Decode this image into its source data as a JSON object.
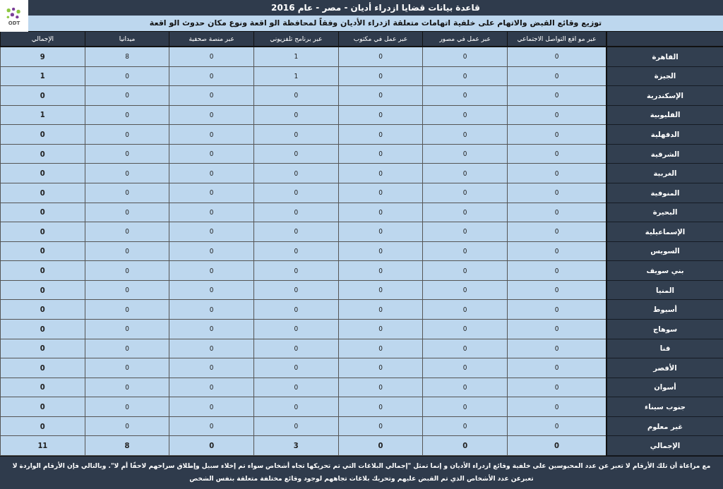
{
  "logo": {
    "text": "ODT"
  },
  "title": "قاعدة بيانات قضايا ازدراء أديان - مصر - عام 2016",
  "subtitle": "توزيع وقائع القبض والاتهام على خلفية اتهامات متعلقة ازدراء الأديان وفقاً لمحافظة الو اقعة ونوع مكان حدوث الو اقعة",
  "table": {
    "columns": [
      "عبر مو اقع التواصل الاجتماعي",
      "عبر عمل في مصور",
      "عبر عمل في مكتوب",
      "عبر برنامج تلفزيوني",
      "عبر منصة صحفية",
      "ميدانيا",
      "الإجمالي"
    ],
    "rows": [
      {
        "label": "القاهرة",
        "values": [
          "0",
          "0",
          "0",
          "1",
          "0",
          "8",
          "9"
        ]
      },
      {
        "label": "الجيزة",
        "values": [
          "0",
          "0",
          "0",
          "1",
          "0",
          "0",
          "1"
        ]
      },
      {
        "label": "الإسكندرية",
        "values": [
          "0",
          "0",
          "0",
          "0",
          "0",
          "0",
          "0"
        ]
      },
      {
        "label": "القليوبية",
        "values": [
          "0",
          "0",
          "0",
          "0",
          "0",
          "0",
          "1"
        ]
      },
      {
        "label": "الدقهلية",
        "values": [
          "0",
          "0",
          "0",
          "0",
          "0",
          "0",
          "0"
        ]
      },
      {
        "label": "الشرقية",
        "values": [
          "0",
          "0",
          "0",
          "0",
          "0",
          "0",
          "0"
        ]
      },
      {
        "label": "الغربية",
        "values": [
          "0",
          "0",
          "0",
          "0",
          "0",
          "0",
          "0"
        ]
      },
      {
        "label": "المنوفية",
        "values": [
          "0",
          "0",
          "0",
          "0",
          "0",
          "0",
          "0"
        ]
      },
      {
        "label": "البحيرة",
        "values": [
          "0",
          "0",
          "0",
          "0",
          "0",
          "0",
          "0"
        ]
      },
      {
        "label": "الإسماعيلية",
        "values": [
          "0",
          "0",
          "0",
          "0",
          "0",
          "0",
          "0"
        ]
      },
      {
        "label": "السويس",
        "values": [
          "0",
          "0",
          "0",
          "0",
          "0",
          "0",
          "0"
        ]
      },
      {
        "label": "بني سويف",
        "values": [
          "0",
          "0",
          "0",
          "0",
          "0",
          "0",
          "0"
        ]
      },
      {
        "label": "المنيا",
        "values": [
          "0",
          "0",
          "0",
          "0",
          "0",
          "0",
          "0"
        ]
      },
      {
        "label": "أسيوط",
        "values": [
          "0",
          "0",
          "0",
          "0",
          "0",
          "0",
          "0"
        ]
      },
      {
        "label": "سوهاج",
        "values": [
          "0",
          "0",
          "0",
          "0",
          "0",
          "0",
          "0"
        ]
      },
      {
        "label": "قنا",
        "values": [
          "0",
          "0",
          "0",
          "0",
          "0",
          "0",
          "0"
        ]
      },
      {
        "label": "الأقصر",
        "values": [
          "0",
          "0",
          "0",
          "0",
          "0",
          "0",
          "0"
        ]
      },
      {
        "label": "أسوان",
        "values": [
          "0",
          "0",
          "0",
          "0",
          "0",
          "0",
          "0"
        ]
      },
      {
        "label": "جنوب سيناء",
        "values": [
          "0",
          "0",
          "0",
          "0",
          "0",
          "0",
          "0"
        ]
      },
      {
        "label": "غير معلوم",
        "values": [
          "0",
          "0",
          "0",
          "0",
          "0",
          "0",
          "0"
        ]
      },
      {
        "label": "الإجمالي",
        "kind": "total",
        "values": [
          "0",
          "0",
          "0",
          "3",
          "0",
          "8",
          "11"
        ]
      }
    ]
  },
  "note": "مع مراعاة أن تلك الأرقام لا تعبر عن عدد المحبوسين على خلفية وقائع ازدراء الأديان و إنما تمثل \"إجمالي البلاغات التي تم تحريكها تجاه أشخاص سواء تم إخلاء سبيل وإطلاق سراحهم لاحقًا أم لا\". وبالتالي فإن الأرقام الواردة لا تعبرعن عدد الأشخاص الذي تم القبض عليهم وتحريك بلاغات تجاههم لوجود وقائع مختلفة متعلقة بنفس الشخص"
}
